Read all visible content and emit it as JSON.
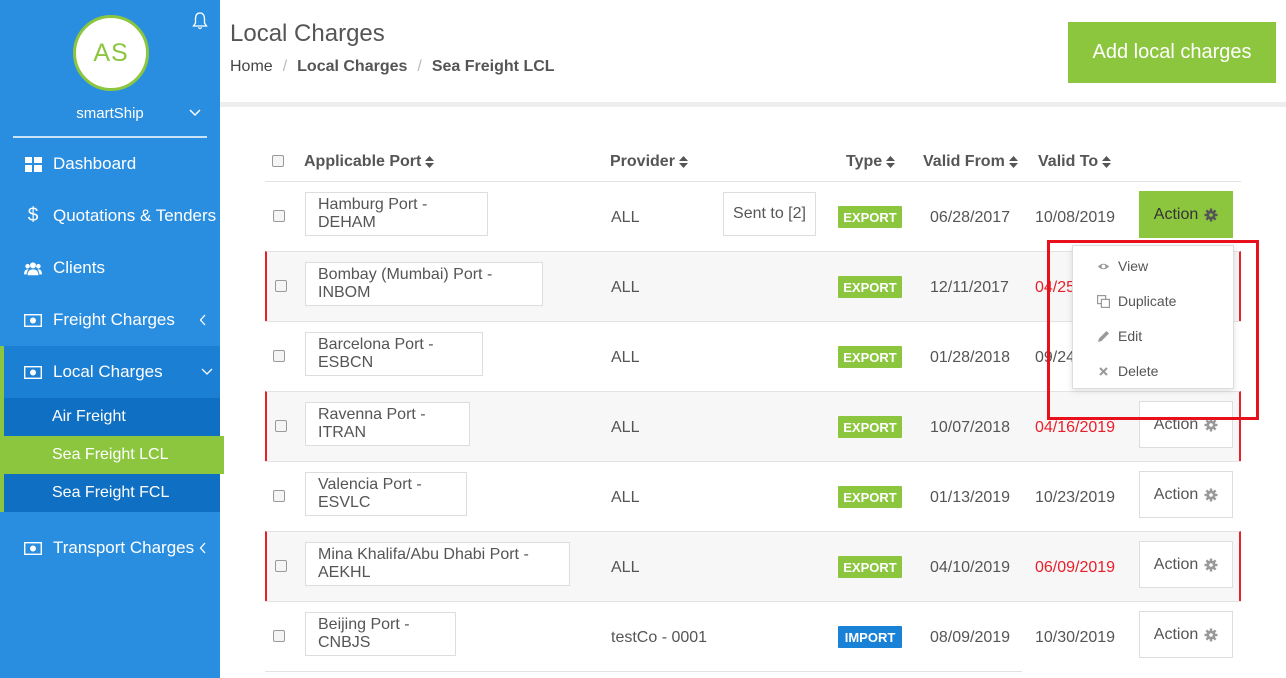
{
  "user": {
    "initials": "AS",
    "name": "smartShip"
  },
  "nav": {
    "dashboard": "Dashboard",
    "quotations": "Quotations & Tenders",
    "clients": "Clients",
    "freight_charges": "Freight Charges",
    "local_charges": "Local Charges",
    "sub": {
      "air": "Air Freight",
      "lcl": "Sea Freight LCL",
      "fcl": "Sea Freight FCL"
    },
    "transport": "Transport Charges"
  },
  "header": {
    "title": "Local Charges",
    "breadcrumb": [
      "Home",
      "Local Charges",
      "Sea Freight LCL"
    ],
    "add_button": "Add local charges"
  },
  "table": {
    "columns": [
      "Applicable Port",
      "Provider",
      "Type",
      "Valid From",
      "Valid To"
    ],
    "rows": [
      {
        "port": "Hamburg Port - DEHAM",
        "provider": "ALL",
        "sent": "Sent to [2]",
        "type": "EXPORT",
        "valid_from": "06/28/2017",
        "valid_to": "10/08/2019",
        "action": "Action"
      },
      {
        "port": "Bombay (Mumbai) Port - INBOM",
        "provider": "ALL",
        "type": "EXPORT",
        "valid_from": "12/11/2017",
        "valid_to": "04/25",
        "action": "Action"
      },
      {
        "port": "Barcelona Port - ESBCN",
        "provider": "ALL",
        "type": "EXPORT",
        "valid_from": "01/28/2018",
        "valid_to": "09/24",
        "action": "Action"
      },
      {
        "port": "Ravenna Port - ITRAN",
        "provider": "ALL",
        "type": "EXPORT",
        "valid_from": "10/07/2018",
        "valid_to": "04/16/2019",
        "action": "Action"
      },
      {
        "port": "Valencia Port - ESVLC",
        "provider": "ALL",
        "type": "EXPORT",
        "valid_from": "01/13/2019",
        "valid_to": "10/23/2019",
        "action": "Action"
      },
      {
        "port": "Mina Khalifa/Abu Dhabi Port - AEKHL",
        "provider": "ALL",
        "type": "EXPORT",
        "valid_from": "04/10/2019",
        "valid_to": "06/09/2019",
        "action": "Action"
      },
      {
        "port": "Beijing Port - CNBJS",
        "provider": "testCo - 0001",
        "type": "IMPORT",
        "valid_from": "08/09/2019",
        "valid_to": "10/30/2019",
        "action": "Action"
      }
    ]
  },
  "dropdown": {
    "view": "View",
    "duplicate": "Duplicate",
    "edit": "Edit",
    "delete": "Delete"
  },
  "colors": {
    "sidebar": "#2a8ee0",
    "accent": "#8cc63f",
    "expired": "#e8202a",
    "import": "#1a82d6"
  }
}
